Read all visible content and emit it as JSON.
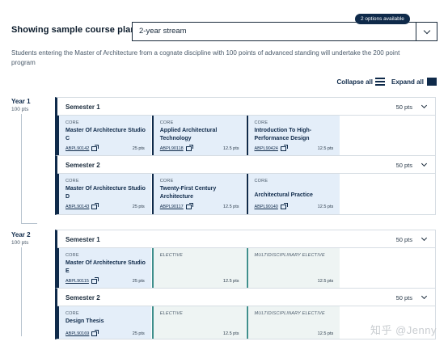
{
  "header": {
    "label": "Showing sample course plan:",
    "selected_plan": "2-year stream",
    "options_badge": "2 options available"
  },
  "intro": "Students entering the Master of Architecture from a cognate discipline with 100 points of advanced standing will undertake the 200 point program",
  "controls": {
    "collapse": "Collapse all",
    "expand": "Expand all"
  },
  "years": [
    {
      "label": "Year 1",
      "pts": "100 pts",
      "semesters": [
        {
          "title": "Semester 1",
          "pts": "50 pts",
          "units": [
            {
              "tag": "CORE",
              "name": "Master Of Architecture Studio C",
              "code": "ABPL90142",
              "pts": "25 pts"
            },
            {
              "tag": "CORE",
              "name": "Applied Architectural Technology",
              "code": "ABPL90118",
              "pts": "12.5 pts"
            },
            {
              "tag": "CORE",
              "name": "Introduction To High-Performance Design",
              "code": "ABPL90424",
              "pts": "12.5 pts"
            }
          ]
        },
        {
          "title": "Semester 2",
          "pts": "50 pts",
          "units": [
            {
              "tag": "CORE",
              "name": "Master Of Architecture Studio D",
              "code": "ABPL90143",
              "pts": "25 pts"
            },
            {
              "tag": "CORE",
              "name": "Twenty-First Century Architecture",
              "code": "ABPL90117",
              "pts": "12.5 pts"
            },
            {
              "tag": "CORE",
              "name": "Architectural Practice",
              "code": "ABPL90140",
              "pts": "12.5 pts"
            }
          ]
        }
      ]
    },
    {
      "label": "Year 2",
      "pts": "100 pts",
      "semesters": [
        {
          "title": "Semester 1",
          "pts": "50 pts",
          "units": [
            {
              "tag": "CORE",
              "name": "Master Of Architecture Studio E",
              "code": "ABPL90115",
              "pts": "25 pts"
            },
            {
              "tag": "ELECTIVE",
              "name": "",
              "code": "",
              "pts": "12.5 pts"
            },
            {
              "tag": "MULTIDISCIPLINARY ELECTIVE",
              "name": "",
              "code": "",
              "pts": "12.5 pts"
            }
          ]
        },
        {
          "title": "Semester 2",
          "pts": "50 pts",
          "units": [
            {
              "tag": "CORE",
              "name": "Design Thesis",
              "code": "ABPL90169",
              "pts": "25 pts"
            },
            {
              "tag": "ELECTIVE",
              "name": "",
              "code": "",
              "pts": "12.5 pts"
            },
            {
              "tag": "MULTIDISCIPLINARY ELECTIVE",
              "name": "",
              "code": "",
              "pts": "12.5 pts"
            }
          ]
        }
      ]
    }
  ],
  "watermark": "知乎 @Jenny"
}
